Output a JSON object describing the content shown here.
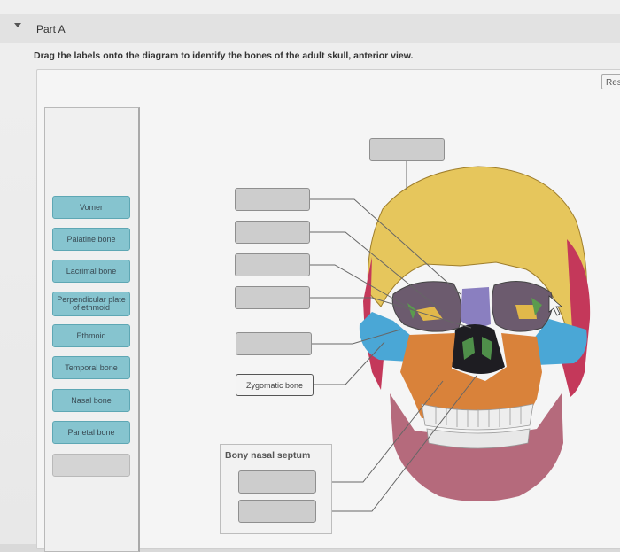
{
  "part": {
    "title": "Part A"
  },
  "instruction": "Drag the labels onto the diagram to identify the bones of the adult skull, anterior view.",
  "reset_button": "Res",
  "label_bank": [
    {
      "label": "Vomer"
    },
    {
      "label": "Palatine bone"
    },
    {
      "label": "Lacrimal bone"
    },
    {
      "label": "Perpendicular plate of ethmoid"
    },
    {
      "label": "Ethmoid"
    },
    {
      "label": "Temporal bone"
    },
    {
      "label": "Nasal bone"
    },
    {
      "label": "Parietal bone"
    },
    {
      "label": ""
    }
  ],
  "placed_label": "Zygomatic bone",
  "group_title": "Bony nasal septum",
  "colors": {
    "label_tile": "#86c4cf",
    "drop_zone": "#cdcdcd",
    "frontal_bone": "#e6c65c",
    "zygomatic_bone": "#4aa7d6",
    "maxilla": "#d9823a",
    "mandible": "#b56a7c",
    "temporal_bone": "#c4385a",
    "nasal_bone": "#8a7fc0"
  }
}
